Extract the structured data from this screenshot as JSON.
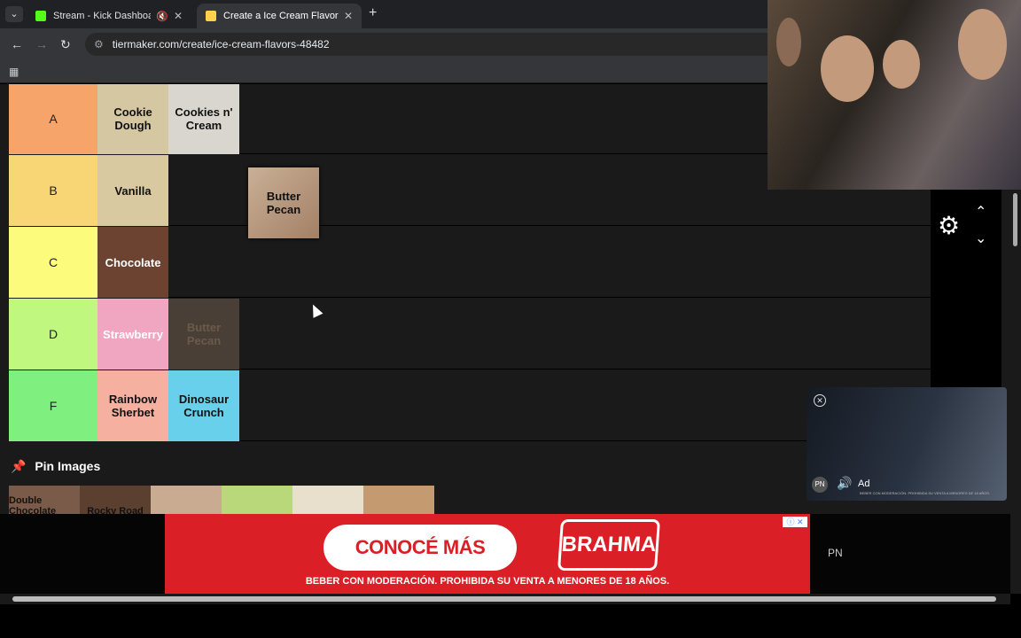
{
  "browser": {
    "tabs": [
      {
        "label": "Stream - Kick Dashboard",
        "favicon_color": "#53fc18"
      },
      {
        "label": "Create a Ice Cream Flavors Tier",
        "favicon_color": "#ffd24a"
      }
    ],
    "url": "tiermaker.com/create/ice-cream-flavors-48482",
    "new_tab": "+",
    "close_glyph": "✕"
  },
  "tiers": [
    {
      "label": "A",
      "color": "#f7a46a",
      "items": [
        {
          "name": "Cookie Dough",
          "bg": "#d6c7a3"
        },
        {
          "name": "Cookies n' Cream",
          "bg": "#d9d6cf"
        }
      ]
    },
    {
      "label": "B",
      "color": "#f8d676",
      "items": [
        {
          "name": "Vanilla",
          "bg": "#d9c9a0"
        }
      ]
    },
    {
      "label": "C",
      "color": "#fdfb7c",
      "items": [
        {
          "name": "Chocolate",
          "bg": "#6b4330"
        }
      ]
    },
    {
      "label": "D",
      "color": "#bff77f",
      "items": [
        {
          "name": "Strawberry",
          "bg": "#f0a6c0"
        },
        {
          "name": "Butter Pecan",
          "bg": "#4a3f36"
        }
      ]
    },
    {
      "label": "F",
      "color": "#7ff07f",
      "items": [
        {
          "name": "Rainbow Sherbet",
          "bg": "#f5b0a0"
        },
        {
          "name": "Dinosaur Crunch",
          "bg": "#69d0ec"
        }
      ]
    }
  ],
  "dragging_item": "Butter Pecan",
  "pin_images_label": "Pin Images",
  "pool_items": [
    {
      "name": "Double Chocolate",
      "bg": "#7a5a48"
    },
    {
      "name": "Rocky Road",
      "bg": "#5b4030"
    },
    {
      "name": "",
      "bg": "#c8ab90"
    },
    {
      "name": "",
      "bg": "#b8d87a"
    },
    {
      "name": "",
      "bg": "#e8e0cc"
    },
    {
      "name": "",
      "bg": "#c49a70"
    }
  ],
  "video_ad": {
    "ad_label": "Ad",
    "logo": "PN",
    "fine_print": "BEBER CON MODERACIÓN. PROHIBIDA SU VENTA A MENORES DE 18 AÑOS."
  },
  "banner": {
    "cta": "CONOCÉ MÁS",
    "brand": "BRAHMA",
    "legal": "BEBER CON MODERACIÓN. PROHIBIDA SU VENTA A MENORES DE 18 AÑOS.",
    "side_logo": "PN"
  }
}
